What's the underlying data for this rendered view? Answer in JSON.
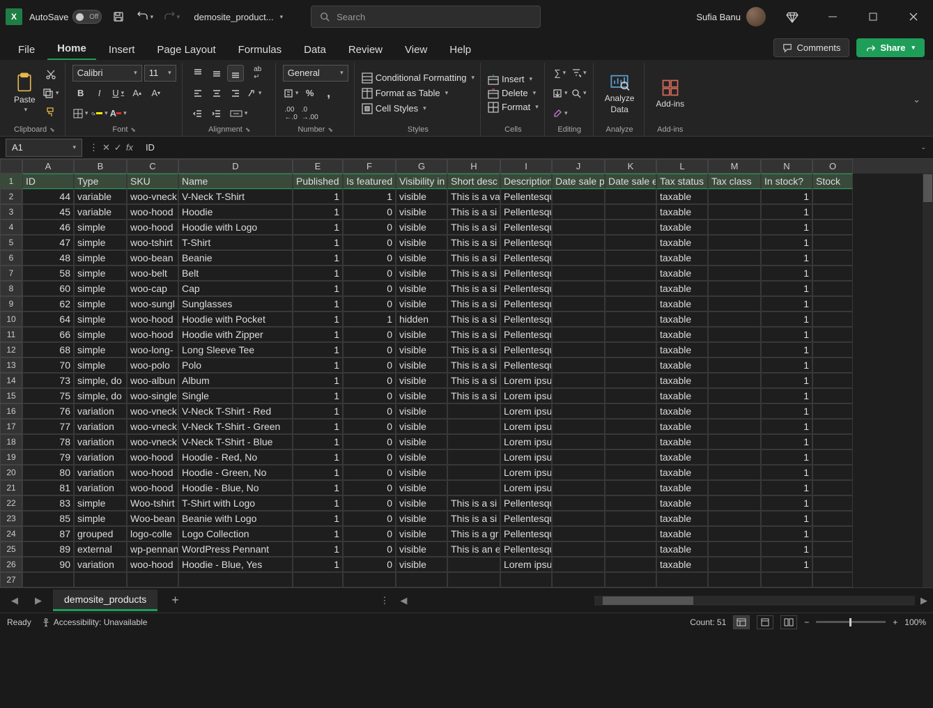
{
  "title_bar": {
    "autosave": "AutoSave",
    "autosave_state": "Off",
    "doc_name": "demosite_product...",
    "search_placeholder": "Search",
    "user": "Sufia Banu"
  },
  "tabs": {
    "items": [
      "File",
      "Home",
      "Insert",
      "Page Layout",
      "Formulas",
      "Data",
      "Review",
      "View",
      "Help"
    ],
    "active": "Home",
    "comments": "Comments",
    "share": "Share"
  },
  "ribbon": {
    "clipboard": {
      "paste": "Paste",
      "label": "Clipboard"
    },
    "font": {
      "name": "Calibri",
      "size": "11",
      "label": "Font"
    },
    "alignment": {
      "label": "Alignment"
    },
    "number": {
      "format": "General",
      "label": "Number"
    },
    "styles": {
      "cond": "Conditional Formatting",
      "table": "Format as Table",
      "cell": "Cell Styles",
      "label": "Styles"
    },
    "cells": {
      "insert": "Insert",
      "delete": "Delete",
      "format": "Format",
      "label": "Cells"
    },
    "editing": {
      "label": "Editing"
    },
    "analyze": {
      "top": "Analyze",
      "bottom": "Data",
      "label": "Analyze"
    },
    "addins": {
      "btn": "Add-ins",
      "label": "Add-ins"
    }
  },
  "formula_bar": {
    "name_box": "A1",
    "value": "ID"
  },
  "columns": [
    "A",
    "B",
    "C",
    "D",
    "E",
    "F",
    "G",
    "H",
    "I",
    "J",
    "K",
    "L",
    "M",
    "N",
    "O"
  ],
  "headers": [
    "ID",
    "Type",
    "SKU",
    "Name",
    "Published",
    "Is featured",
    "Visibility in",
    "Short desc",
    "Description",
    "Date sale p",
    "Date sale e",
    "Tax status",
    "Tax class",
    "In stock?",
    "Stock"
  ],
  "rows": [
    {
      "n": 2,
      "d": [
        "44",
        "variable",
        "woo-vneck",
        "V-Neck T-Shirt",
        "1",
        "1",
        "visible",
        "This is a va",
        "Pellentesque habitant morbi trist",
        "",
        "",
        "taxable",
        "",
        "1",
        ""
      ]
    },
    {
      "n": 3,
      "d": [
        "45",
        "variable",
        "woo-hood",
        "Hoodie",
        "1",
        "0",
        "visible",
        "This is a si",
        "Pellentesque habitant morbi trist",
        "",
        "",
        "taxable",
        "",
        "1",
        ""
      ]
    },
    {
      "n": 4,
      "d": [
        "46",
        "simple",
        "woo-hood",
        "Hoodie with Logo",
        "1",
        "0",
        "visible",
        "This is a si",
        "Pellentesque habitant morbi trist",
        "",
        "",
        "taxable",
        "",
        "1",
        ""
      ]
    },
    {
      "n": 5,
      "d": [
        "47",
        "simple",
        "woo-tshirt",
        "T-Shirt",
        "1",
        "0",
        "visible",
        "This is a si",
        "Pellentesque habitant morbi trist",
        "",
        "",
        "taxable",
        "",
        "1",
        ""
      ]
    },
    {
      "n": 6,
      "d": [
        "48",
        "simple",
        "woo-bean",
        "Beanie",
        "1",
        "0",
        "visible",
        "This is a si",
        "Pellentesque habitant morbi trist",
        "",
        "",
        "taxable",
        "",
        "1",
        ""
      ]
    },
    {
      "n": 7,
      "d": [
        "58",
        "simple",
        "woo-belt",
        "Belt",
        "1",
        "0",
        "visible",
        "This is a si",
        "Pellentesque habitant morbi trist",
        "",
        "",
        "taxable",
        "",
        "1",
        ""
      ]
    },
    {
      "n": 8,
      "d": [
        "60",
        "simple",
        "woo-cap",
        "Cap",
        "1",
        "0",
        "visible",
        "This is a si",
        "Pellentesque habitant morbi trist",
        "",
        "",
        "taxable",
        "",
        "1",
        ""
      ]
    },
    {
      "n": 9,
      "d": [
        "62",
        "simple",
        "woo-sungl",
        "Sunglasses",
        "1",
        "0",
        "visible",
        "This is a si",
        "Pellentesque habitant morbi trist",
        "",
        "",
        "taxable",
        "",
        "1",
        ""
      ]
    },
    {
      "n": 10,
      "d": [
        "64",
        "simple",
        "woo-hood",
        "Hoodie with Pocket",
        "1",
        "1",
        "hidden",
        "This is a si",
        "Pellentesque habitant morbi trist",
        "",
        "",
        "taxable",
        "",
        "1",
        ""
      ]
    },
    {
      "n": 11,
      "d": [
        "66",
        "simple",
        "woo-hood",
        "Hoodie with Zipper",
        "1",
        "0",
        "visible",
        "This is a si",
        "Pellentesque habitant morbi trist",
        "",
        "",
        "taxable",
        "",
        "1",
        ""
      ]
    },
    {
      "n": 12,
      "d": [
        "68",
        "simple",
        "woo-long-",
        "Long Sleeve Tee",
        "1",
        "0",
        "visible",
        "This is a si",
        "Pellentesque habitant morbi trist",
        "",
        "",
        "taxable",
        "",
        "1",
        ""
      ]
    },
    {
      "n": 13,
      "d": [
        "70",
        "simple",
        "woo-polo",
        "Polo",
        "1",
        "0",
        "visible",
        "This is a si",
        "Pellentesque habitant morbi trist",
        "",
        "",
        "taxable",
        "",
        "1",
        ""
      ]
    },
    {
      "n": 14,
      "d": [
        "73",
        "simple, do",
        "woo-albun",
        "Album",
        "1",
        "0",
        "visible",
        "This is a si",
        "Lorem ipsum dolor sit amet, con",
        "",
        "",
        "taxable",
        "",
        "1",
        ""
      ]
    },
    {
      "n": 15,
      "d": [
        "75",
        "simple, do",
        "woo-single",
        "Single",
        "1",
        "0",
        "visible",
        "This is a si",
        "Lorem ipsum dolor sit amet, con",
        "",
        "",
        "taxable",
        "",
        "1",
        ""
      ]
    },
    {
      "n": 16,
      "d": [
        "76",
        "variation",
        "woo-vneck",
        "V-Neck T-Shirt - Red",
        "1",
        "0",
        "visible",
        "",
        "Lorem ipsum dolor sit amet, con",
        "",
        "",
        "taxable",
        "",
        "1",
        ""
      ]
    },
    {
      "n": 17,
      "d": [
        "77",
        "variation",
        "woo-vneck",
        "V-Neck T-Shirt - Green",
        "1",
        "0",
        "visible",
        "",
        "Lorem ipsum dolor sit amet, con",
        "",
        "",
        "taxable",
        "",
        "1",
        ""
      ]
    },
    {
      "n": 18,
      "d": [
        "78",
        "variation",
        "woo-vneck",
        "V-Neck T-Shirt - Blue",
        "1",
        "0",
        "visible",
        "",
        "Lorem ipsum dolor sit amet, con",
        "",
        "",
        "taxable",
        "",
        "1",
        ""
      ]
    },
    {
      "n": 19,
      "d": [
        "79",
        "variation",
        "woo-hood",
        "Hoodie - Red, No",
        "1",
        "0",
        "visible",
        "",
        "Lorem ipsum dolor sit amet, con",
        "",
        "",
        "taxable",
        "",
        "1",
        ""
      ]
    },
    {
      "n": 20,
      "d": [
        "80",
        "variation",
        "woo-hood",
        "Hoodie - Green, No",
        "1",
        "0",
        "visible",
        "",
        "Lorem ipsum dolor sit amet, con",
        "",
        "",
        "taxable",
        "",
        "1",
        ""
      ]
    },
    {
      "n": 21,
      "d": [
        "81",
        "variation",
        "woo-hood",
        "Hoodie - Blue, No",
        "1",
        "0",
        "visible",
        "",
        "Lorem ipsum dolor sit amet, con",
        "",
        "",
        "taxable",
        "",
        "1",
        ""
      ]
    },
    {
      "n": 22,
      "d": [
        "83",
        "simple",
        "Woo-tshirt",
        "T-Shirt with Logo",
        "1",
        "0",
        "visible",
        "This is a si",
        "Pellentesque habitant morbi trist",
        "",
        "",
        "taxable",
        "",
        "1",
        ""
      ]
    },
    {
      "n": 23,
      "d": [
        "85",
        "simple",
        "Woo-bean",
        "Beanie with Logo",
        "1",
        "0",
        "visible",
        "This is a si",
        "Pellentesque habitant morbi trist",
        "",
        "",
        "taxable",
        "",
        "1",
        ""
      ]
    },
    {
      "n": 24,
      "d": [
        "87",
        "grouped",
        "logo-colle",
        "Logo Collection",
        "1",
        "0",
        "visible",
        "This is a gr",
        "Pellentesque habitant morbi trist",
        "",
        "",
        "taxable",
        "",
        "1",
        ""
      ]
    },
    {
      "n": 25,
      "d": [
        "89",
        "external",
        "wp-pennan",
        "WordPress Pennant",
        "1",
        "0",
        "visible",
        "This is an e",
        "Pellentesque habitant morbi trist",
        "",
        "",
        "taxable",
        "",
        "1",
        ""
      ]
    },
    {
      "n": 26,
      "d": [
        "90",
        "variation",
        "woo-hood",
        "Hoodie - Blue, Yes",
        "1",
        "0",
        "visible",
        "",
        "Lorem ipsum dolor sit amet, con",
        "",
        "",
        "taxable",
        "",
        "1",
        ""
      ]
    },
    {
      "n": 27,
      "d": [
        "",
        "",
        "",
        "",
        "",
        "",
        "",
        "",
        "",
        "",
        "",
        "",
        "",
        "",
        ""
      ]
    }
  ],
  "sheet_tab": "demosite_products",
  "status": {
    "ready": "Ready",
    "access": "Accessibility: Unavailable",
    "count": "Count: 51",
    "zoom": "100%"
  }
}
